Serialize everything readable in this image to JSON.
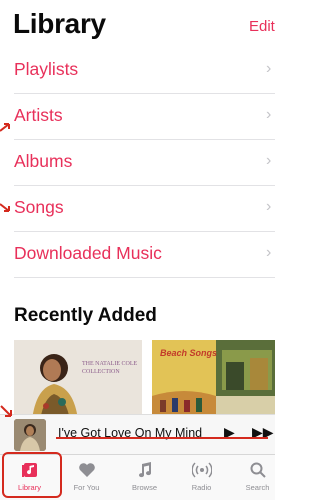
{
  "header": {
    "title": "Library",
    "edit_label": "Edit"
  },
  "menu": {
    "items": [
      {
        "label": "Playlists"
      },
      {
        "label": "Artists"
      },
      {
        "label": "Albums"
      },
      {
        "label": "Songs"
      },
      {
        "label": "Downloaded Music"
      }
    ]
  },
  "recently_added": {
    "title": "Recently Added",
    "albums": [
      {
        "cover_text": "THE NATALIE COLE COLLECTION"
      },
      {
        "cover_text": "Beach Songs"
      }
    ]
  },
  "mini_player": {
    "title": "I've Got Love On My Mind"
  },
  "tabbar": {
    "tabs": [
      {
        "label": "Library",
        "icon": "library-icon",
        "active": true
      },
      {
        "label": "For You",
        "icon": "heart-icon",
        "active": false
      },
      {
        "label": "Browse",
        "icon": "music-note-icon",
        "active": false
      },
      {
        "label": "Radio",
        "icon": "radio-icon",
        "active": false
      },
      {
        "label": "Search",
        "icon": "search-icon",
        "active": false
      }
    ]
  },
  "colors": {
    "accent": "#e8305a",
    "annotation_red": "#d42a1e"
  }
}
